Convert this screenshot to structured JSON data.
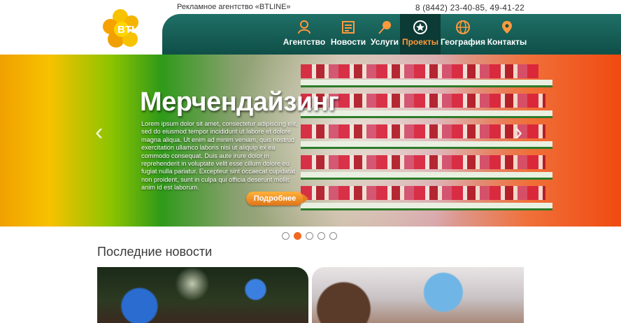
{
  "header": {
    "tagline": "Рекламное агентство «BTLINE»",
    "phone": "8 (8442) 23-40-85, 49-41-22",
    "logo_text": "BTLine"
  },
  "nav": {
    "items": [
      {
        "label": "Агентство",
        "icon": "person-icon"
      },
      {
        "label": "Новости",
        "icon": "newspaper-icon"
      },
      {
        "label": "Услуги",
        "icon": "pin-icon"
      },
      {
        "label": "Проекты",
        "icon": "star-icon",
        "active": true
      },
      {
        "label": "География",
        "icon": "globe-icon"
      },
      {
        "label": "Контакты",
        "icon": "location-icon"
      }
    ]
  },
  "hero": {
    "title": "Мерчендайзинг",
    "text": "Lorem ipsum dolor sit amet, consectetur adipiscing elit, sed do eiusmod tempor incididunt ut labore et dolore magna aliqua. Ut enim ad minim veniam, quis nostrud exercitation ullamco laboris nisi ut aliquip ex ea commodo consequat. Duis aute irure dolor in reprehenderit in voluptate velit esse cillum dolore eu fugiat nulla pariatur. Excepteur sint occaecat cupidatat non proident, sunt in culpa qui officia deserunt mollit anim id est laborum.",
    "button": "Подробнее",
    "prev": "‹",
    "next": "›"
  },
  "slider": {
    "count": 5,
    "active": 2
  },
  "news": {
    "title": "Последние новости"
  },
  "colors": {
    "nav_bg": "#1a665e",
    "accent": "#ef6a1f",
    "active_label": "#ff9a3c"
  }
}
